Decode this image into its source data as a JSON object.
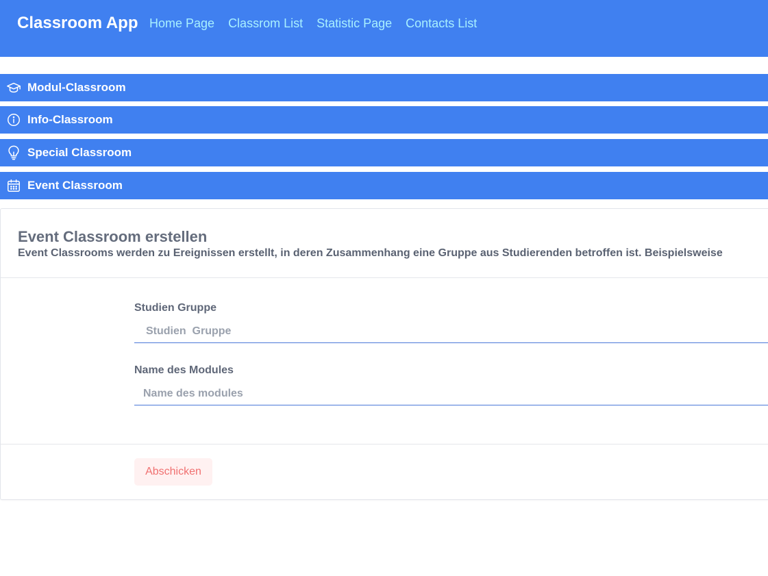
{
  "app": {
    "title": "Classroom App"
  },
  "nav": {
    "links": [
      {
        "label": "Home Page"
      },
      {
        "label": "Classrom List"
      },
      {
        "label": "Statistic Page"
      },
      {
        "label": "Contacts List"
      }
    ]
  },
  "accordion": {
    "items": [
      {
        "label": "Modul-Classroom",
        "icon": "graduation-cap-icon"
      },
      {
        "label": "Info-Classroom",
        "icon": "info-circle-icon"
      },
      {
        "label": "Special Classroom",
        "icon": "lightbulb-icon"
      },
      {
        "label": "Event Classroom",
        "icon": "calendar-icon"
      }
    ]
  },
  "form": {
    "title": "Event Classroom erstellen",
    "description": "Event Classrooms werden zu Ereignissen erstellt, in deren Zusammenhang eine Gruppe aus Studierenden betroffen ist. Beispielsweise",
    "fields": {
      "studien": {
        "label": "Studien Gruppe",
        "placeholder": "Studien  Gruppe",
        "value": ""
      },
      "modul": {
        "label": "Name des Modules",
        "placeholder": "Name des modules",
        "value": ""
      }
    },
    "submit_label": "Abschicken"
  },
  "colors": {
    "primary": "#4080f0",
    "nav_link": "#a8f0ff",
    "heading_text": "#646c7c",
    "input_underline": "#4a78d8",
    "submit_bg": "#fff1f1",
    "submit_text": "#f07070"
  }
}
